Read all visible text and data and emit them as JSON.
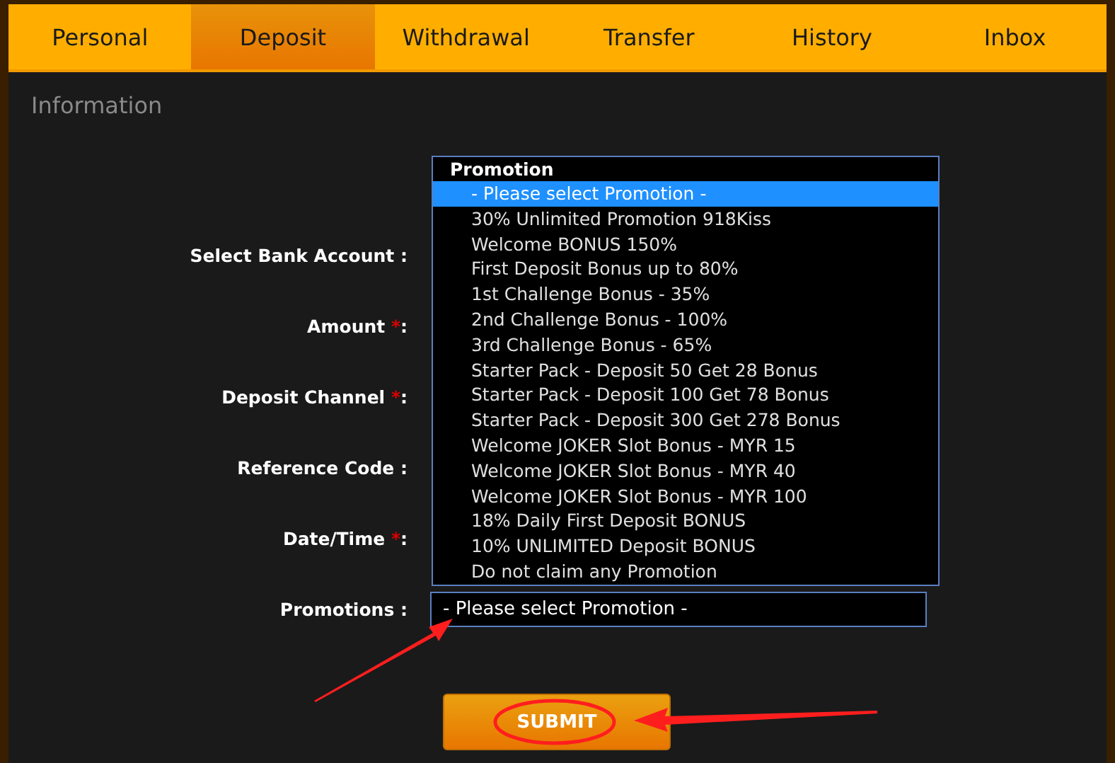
{
  "tabs": [
    {
      "label": "Personal",
      "selected": false
    },
    {
      "label": "Deposit",
      "selected": true
    },
    {
      "label": "Withdrawal",
      "selected": false
    },
    {
      "label": "Transfer",
      "selected": false
    },
    {
      "label": "History",
      "selected": false
    },
    {
      "label": "Inbox",
      "selected": false
    }
  ],
  "section_title": "Information",
  "form_rows": [
    {
      "label": "Select Bank Account :"
    },
    {
      "label": "Amount",
      "required_mark": "*",
      "colon": ":"
    },
    {
      "label": "Deposit Channel",
      "required_mark": "*",
      "colon": ":"
    },
    {
      "label": "Reference Code :"
    },
    {
      "label": "Date/Time",
      "required_mark": "*",
      "colon": ":"
    },
    {
      "label": "Promotions :",
      "kind": "select",
      "value": "- Please select Promotion -"
    }
  ],
  "dropdown": {
    "group_label": "Promotion",
    "options": [
      {
        "label": "- Please select Promotion -",
        "selected": true
      },
      {
        "label": "30% Unlimited Promotion 918Kiss",
        "selected": false
      },
      {
        "label": "Welcome BONUS 150%",
        "selected": false
      },
      {
        "label": "First Deposit Bonus up to 80%",
        "selected": false
      },
      {
        "label": "1st Challenge Bonus - 35%",
        "selected": false
      },
      {
        "label": "2nd Challenge Bonus - 100%",
        "selected": false
      },
      {
        "label": "3rd Challenge Bonus - 65%",
        "selected": false
      },
      {
        "label": "Starter Pack - Deposit 50 Get 28 Bonus",
        "selected": false
      },
      {
        "label": "Starter Pack - Deposit 100 Get 78 Bonus",
        "selected": false
      },
      {
        "label": "Starter Pack - Deposit 300 Get 278 Bonus",
        "selected": false
      },
      {
        "label": "Welcome JOKER Slot Bonus - MYR 15",
        "selected": false
      },
      {
        "label": "Welcome JOKER Slot Bonus - MYR 40",
        "selected": false
      },
      {
        "label": "Welcome JOKER Slot Bonus - MYR 100",
        "selected": false
      },
      {
        "label": "18% Daily First Deposit BONUS",
        "selected": false
      },
      {
        "label": "10% UNLIMITED Deposit BONUS",
        "selected": false
      },
      {
        "label": "Do not claim any Promotion",
        "selected": false
      }
    ]
  },
  "submit_button": "SUBMIT"
}
